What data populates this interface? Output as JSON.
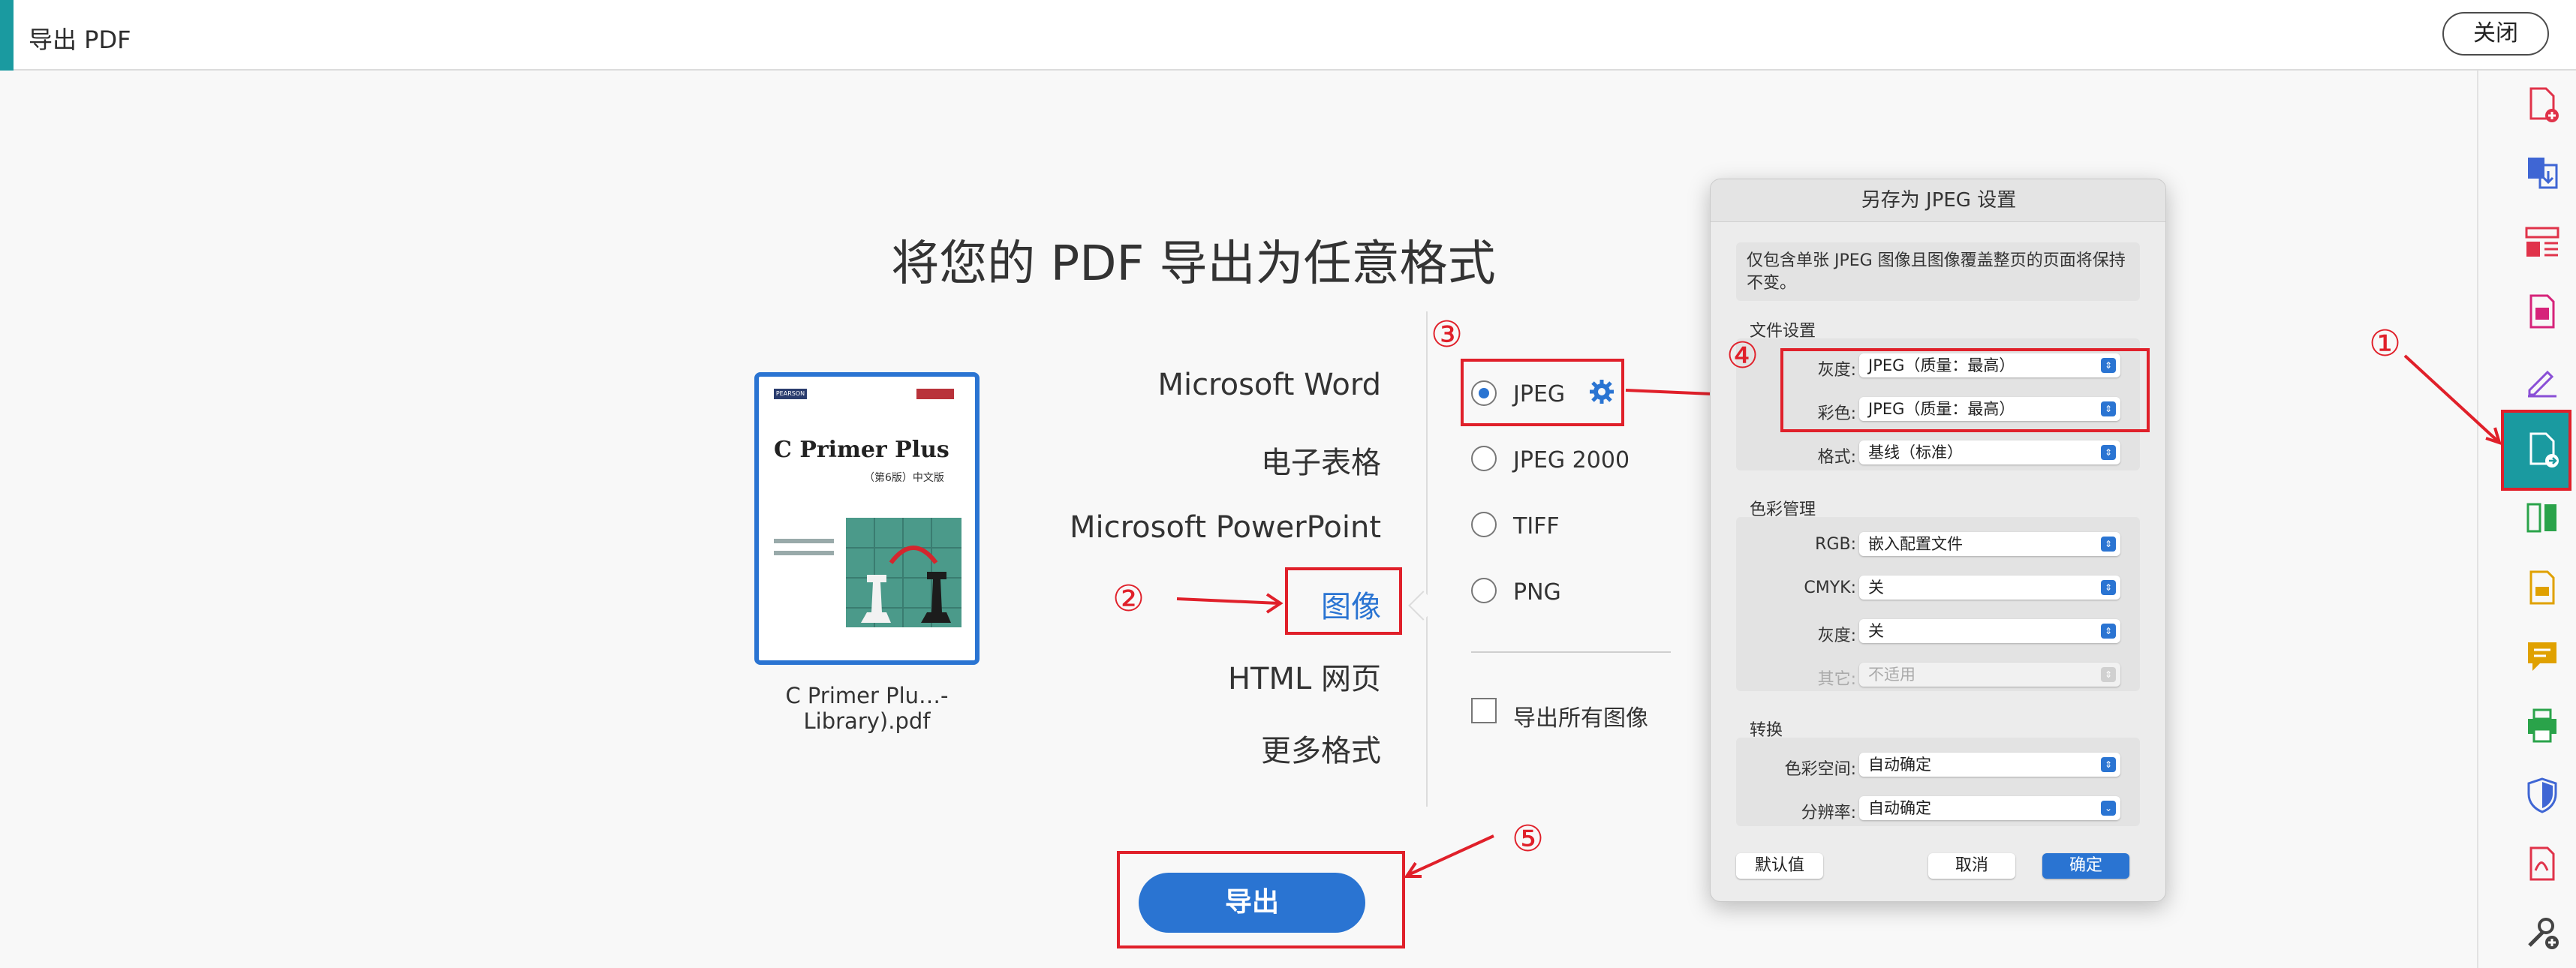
{
  "header": {
    "title": "导出 PDF",
    "close_label": "关闭"
  },
  "headline": "将您的 PDF 导出为任意格式",
  "file": {
    "name": "C Primer Plu…-Library).pdf",
    "cover_title": "C Primer Plus",
    "cover_edition": "（第6版）中文版",
    "cover_publisher": "PEARSON"
  },
  "formats": [
    "Microsoft Word",
    "电子表格",
    "Microsoft PowerPoint",
    "图像",
    "HTML 网页",
    "更多格式"
  ],
  "selected_format": "图像",
  "image_options": [
    {
      "label": "JPEG",
      "selected": true
    },
    {
      "label": "JPEG 2000",
      "selected": false
    },
    {
      "label": "TIFF",
      "selected": false
    },
    {
      "label": "PNG",
      "selected": false
    }
  ],
  "export_all_images_label": "导出所有图像",
  "export_button": "导出",
  "annotations": [
    "①",
    "②",
    "③",
    "④",
    "⑤"
  ],
  "dialog": {
    "title": "另存为 JPEG 设置",
    "description": "仅包含单张 JPEG 图像且图像覆盖整页的页面将保持不变。",
    "file_settings": {
      "heading": "文件设置",
      "grayscale_label": "灰度:",
      "grayscale_value": "JPEG（质量：最高）",
      "color_label": "彩色:",
      "color_value": "JPEG（质量：最高）",
      "format_label": "格式:",
      "format_value": "基线（标准）"
    },
    "color_management": {
      "heading": "色彩管理",
      "rgb_label": "RGB:",
      "rgb_value": "嵌入配置文件",
      "cmyk_label": "CMYK:",
      "cmyk_value": "关",
      "gray_label": "灰度:",
      "gray_value": "关",
      "other_label": "其它:",
      "other_value": "不适用"
    },
    "conversion": {
      "heading": "转换",
      "colorspace_label": "色彩空间:",
      "colorspace_value": "自动确定",
      "resolution_label": "分辨率:",
      "resolution_value": "自动确定"
    },
    "buttons": {
      "defaults": "默认值",
      "cancel": "取消",
      "ok": "确定"
    }
  },
  "colors": {
    "accent": "#1a9aa0",
    "primary": "#2a74d2",
    "annotation": "#e0202a"
  },
  "rail_icons": [
    "create-pdf-icon",
    "combine-files-icon",
    "organize-pages-icon",
    "edit-pdf-icon",
    "fill-sign-icon",
    "export-pdf-icon",
    "compare-icon",
    "comment-icon",
    "speech-bubble-icon",
    "print-production-icon",
    "protect-icon",
    "pdf-standards-icon",
    "more-tools-icon"
  ]
}
